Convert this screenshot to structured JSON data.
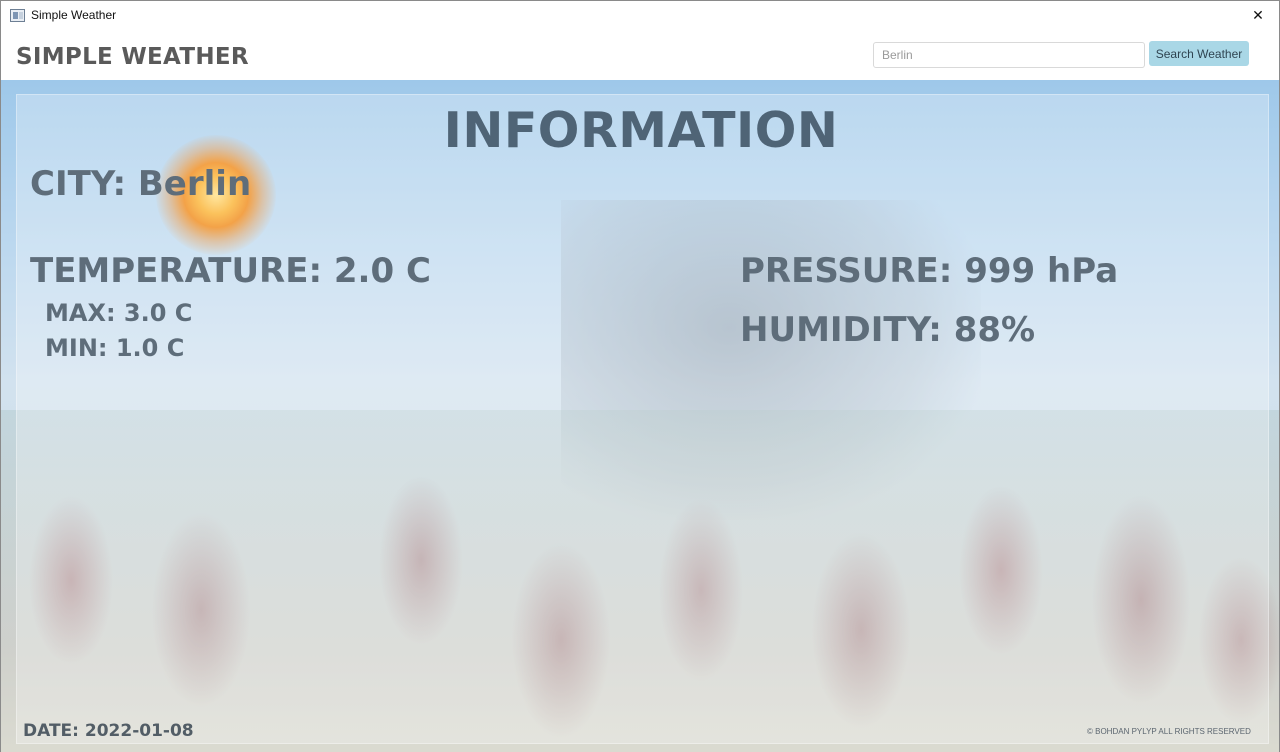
{
  "window": {
    "title": "Simple Weather",
    "icons": {
      "app": "window-app-icon",
      "minimize": "minimize-icon",
      "maximize": "maximize-icon",
      "close": "close-icon"
    },
    "close_glyph": "✕"
  },
  "header": {
    "brand": "SIMPLE WEATHER",
    "search": {
      "value": "Berlin",
      "placeholder": ""
    },
    "search_button": "Search Weather"
  },
  "info": {
    "title": "INFORMATION",
    "city": "CITY: Berlin",
    "temperature": "TEMPERATURE: 2.0 C",
    "max": "MAX: 3.0 C",
    "min": "MIN: 1.0 C",
    "pressure": "PRESSURE: 999 hPa",
    "humidity": "HUMIDITY: 88%",
    "weather_icon": "sun-icon"
  },
  "footer": {
    "date": "DATE: 2022-01-08",
    "copyright": "© BOHDAN PYLYP ALL RIGHTS RESERVED"
  },
  "colors": {
    "accent": "#a9d7e6",
    "text": "#5e6d7a",
    "title": "#4f6476"
  }
}
